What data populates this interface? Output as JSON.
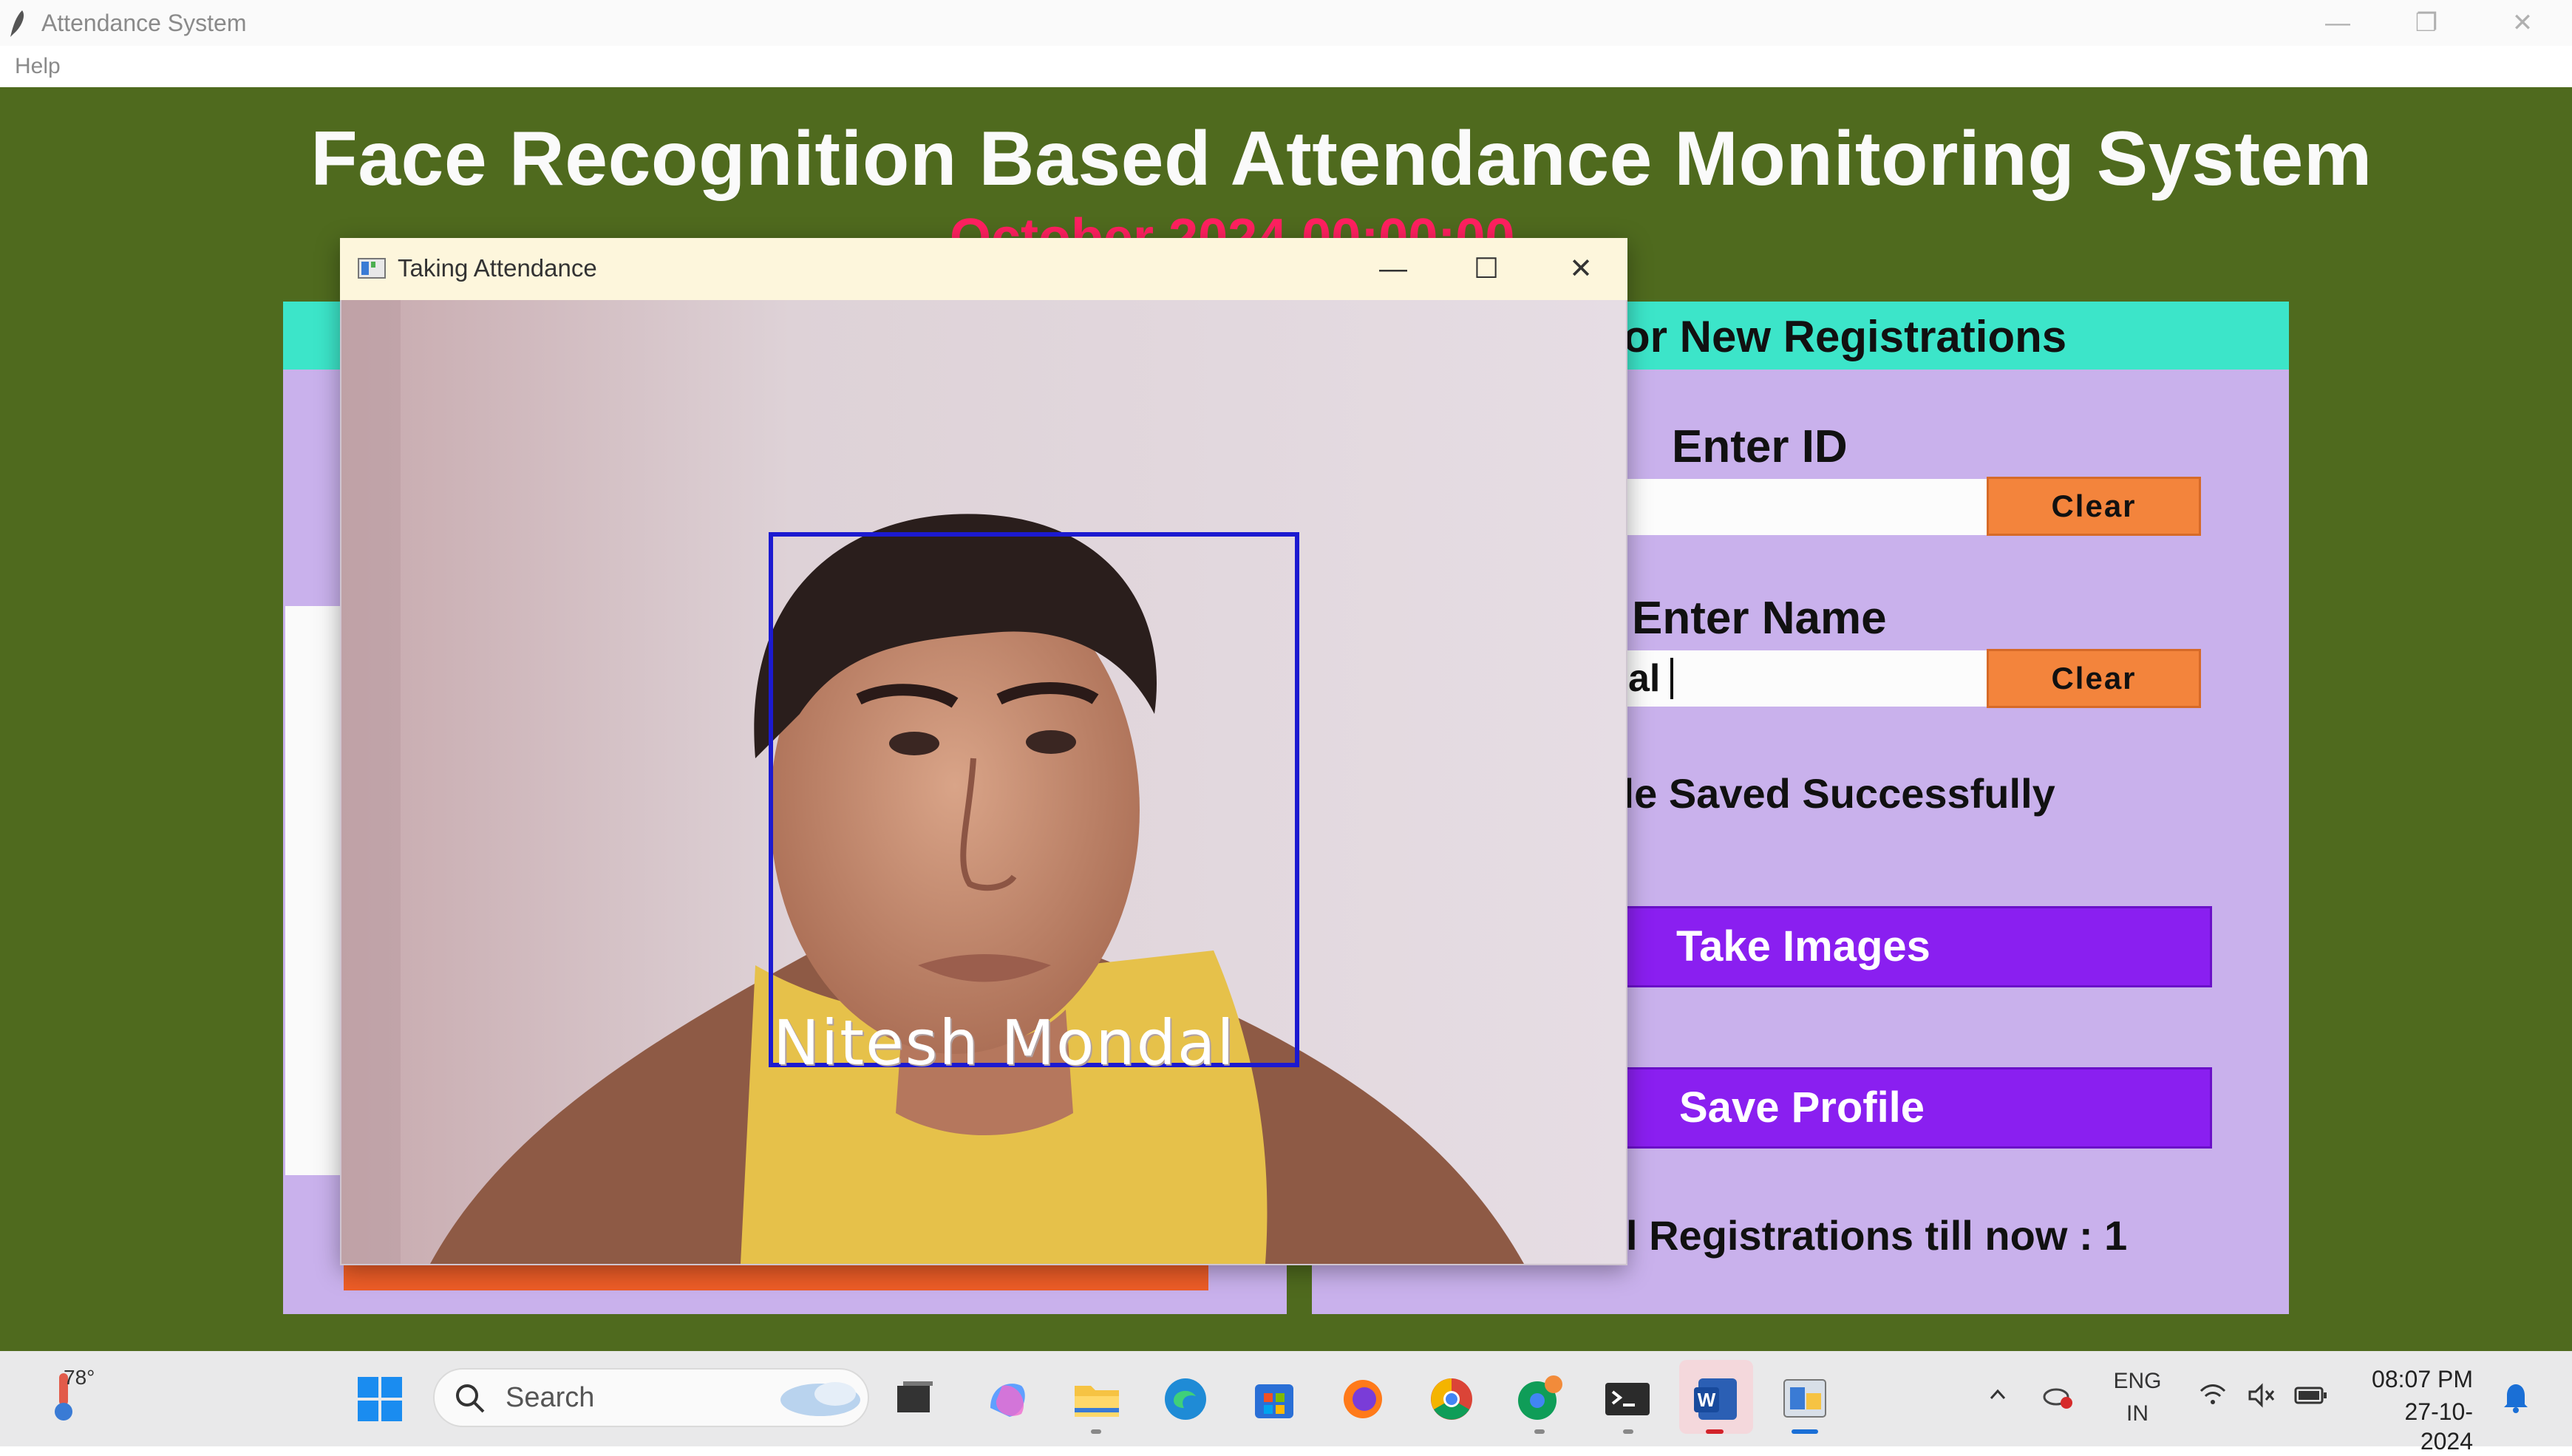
{
  "window": {
    "title": "Attendance System",
    "controls": {
      "minimize": "—",
      "maximize": "❐",
      "close": "✕"
    }
  },
  "menu": {
    "help": "Help"
  },
  "main": {
    "heading": "Face Recognition Based Attendance Monitoring System",
    "date": "October 2024 00:00:00"
  },
  "registration": {
    "title": "or New Registrations",
    "enter_id_label": "Enter ID",
    "id_value": "",
    "enter_name_label": "Enter Name",
    "name_value": "al",
    "clear_label": "Clear",
    "status_message": "ile Saved Successfully",
    "take_images_label": "Take Images",
    "save_profile_label": "Save Profile",
    "total_registrations": "l Registrations till now  : 1"
  },
  "popup": {
    "title": "Taking Attendance",
    "recognized_name": "Nitesh  Mondal"
  },
  "taskbar": {
    "weather_temp": "78°",
    "search_label": "Search",
    "lang_line1": "ENG",
    "lang_line2": "IN",
    "time": "08:07 PM",
    "date": "27-10-2024"
  },
  "colors": {
    "app_background": "#4f6a1e",
    "frame_background": "#c9b1ec",
    "frame_header": "#3ce5c9",
    "clear_button": "#f3843c",
    "action_button": "#8a1ff0",
    "face_box": "#1c1ad0",
    "date_text": "#ff2060"
  }
}
